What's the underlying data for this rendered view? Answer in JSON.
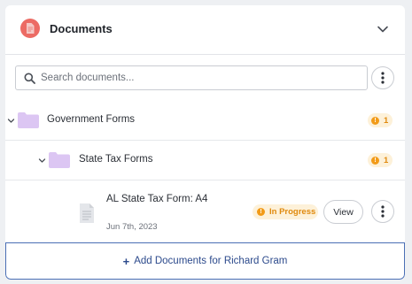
{
  "header": {
    "title": "Documents",
    "icon": "document-icon",
    "badge_color": "#ec6b64"
  },
  "search": {
    "placeholder": "Search documents...",
    "value": ""
  },
  "tree": {
    "folders": [
      {
        "label": "Government Forms",
        "count": "1",
        "icon": "folder-icon"
      },
      {
        "label": "State Tax Forms",
        "count": "1",
        "icon": "folder-icon"
      }
    ],
    "document": {
      "title": "AL State Tax Form: A4",
      "date": "Jun 7th, 2023",
      "status": "In Progress",
      "view_label": "View"
    }
  },
  "footer": {
    "add_label": "Add Documents for Richard Gram",
    "add_icon": "plus-icon"
  },
  "colors": {
    "folder": "#dcc6f3",
    "warning": "#f29b18",
    "warning_bg": "#fdf1d9",
    "accent": "#2c4a8c"
  }
}
